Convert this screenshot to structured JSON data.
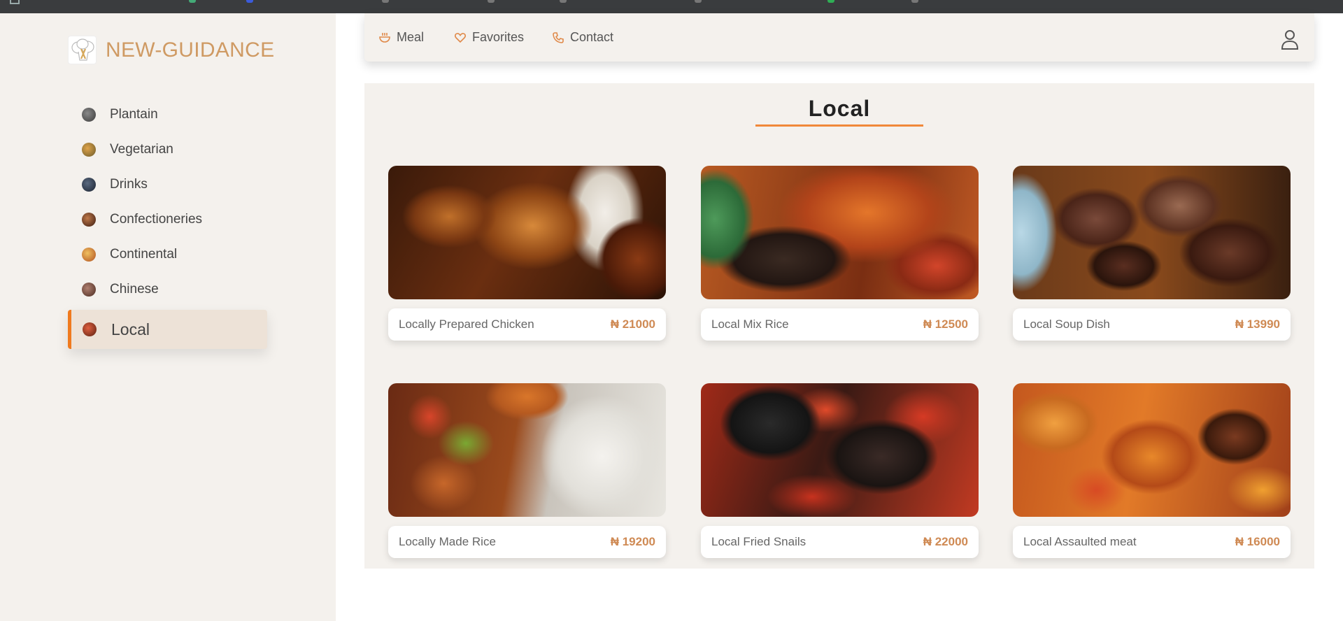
{
  "brand": {
    "name": "NEW-GUIDANCE",
    "accent": "#cf9a63"
  },
  "sidebar": {
    "items": [
      {
        "label": "Plantain",
        "icon": "plantain-thumb-icon",
        "color": "#4a4a4a"
      },
      {
        "label": "Vegetarian",
        "icon": "vegetarian-thumb-icon",
        "color": "#c0843a"
      },
      {
        "label": "Drinks",
        "icon": "drinks-thumb-icon",
        "color": "#2d3a4a"
      },
      {
        "label": "Confectioneries",
        "icon": "confectioneries-thumb-icon",
        "color": "#6a3a22"
      },
      {
        "label": "Continental",
        "icon": "continental-thumb-icon",
        "color": "#d08a30"
      },
      {
        "label": "Chinese",
        "icon": "chinese-thumb-icon",
        "color": "#7a5040"
      },
      {
        "label": "Local",
        "icon": "local-thumb-icon",
        "color": "#a8402a",
        "active": true
      }
    ]
  },
  "nav": {
    "meal": "Meal",
    "favorites": "Favorites",
    "contact": "Contact",
    "user_icon": "user-icon"
  },
  "section": {
    "title": "Local",
    "accent": "#f07a1e"
  },
  "dishes": [
    {
      "name": "Locally Prepared Chicken",
      "price": "₦ 21000"
    },
    {
      "name": "Local Mix Rice",
      "price": "₦ 12500"
    },
    {
      "name": "Local Soup Dish",
      "price": "₦ 13990"
    },
    {
      "name": "Locally Made Rice",
      "price": "₦ 19200"
    },
    {
      "name": "Local Fried Snails",
      "price": "₦ 22000"
    },
    {
      "name": "Local Assaulted meat",
      "price": "₦ 16000"
    }
  ]
}
